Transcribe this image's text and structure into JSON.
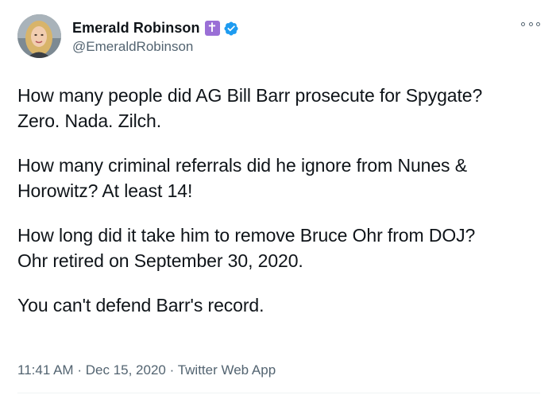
{
  "author": {
    "display_name": "Emerald Robinson",
    "handle": "@EmeraldRobinson",
    "badge_cross": "✝",
    "verified_color": "#1d9bf0",
    "cross_badge_color": "#9a6fd6"
  },
  "tweet": {
    "paragraphs": [
      [
        "How many people did AG Bill Barr prosecute for Spygate?",
        "Zero. Nada. Zilch."
      ],
      [
        "How many criminal referrals did he ignore from Nunes &",
        "Horowitz? At least 14!"
      ],
      [
        "How long did it take him to remove Bruce Ohr from DOJ?",
        "Ohr retired on September 30, 2020."
      ],
      [
        "You can't defend Barr's record."
      ]
    ],
    "time": "11:41 AM",
    "separator": "·",
    "date": "Dec 15, 2020",
    "source": "Twitter Web App"
  },
  "icons": {
    "more": "more-options-icon",
    "verified": "verified-badge-icon",
    "cross": "cross-badge-icon"
  }
}
